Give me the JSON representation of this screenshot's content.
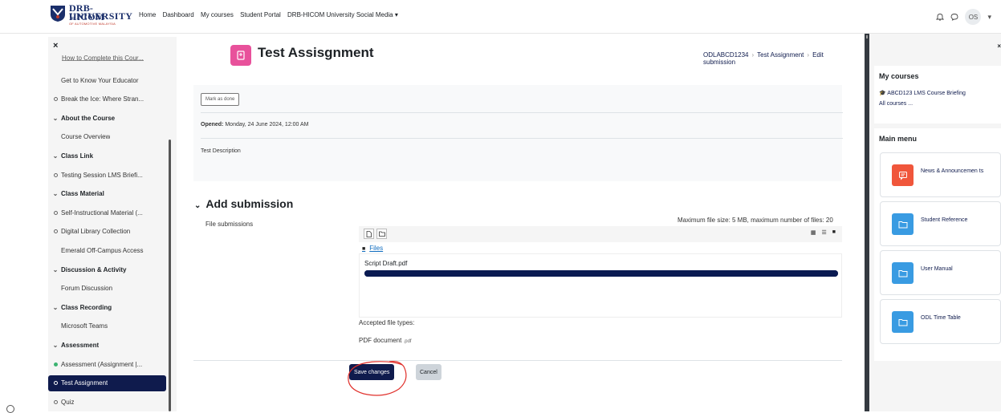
{
  "header": {
    "logo_line1": "DRB-HICOM",
    "logo_line2": "UNIVERSITY",
    "logo_line3": "OF AUTOMOTIVE MALAYSIA",
    "nav": [
      "Home",
      "Dashboard",
      "My courses",
      "Student Portal",
      "DRB-HICOM University Social Media ▾"
    ],
    "avatar_initials": "OS",
    "avatar_caret": "▾"
  },
  "left_drawer": {
    "close": "×",
    "cut_item": "How to Complete this Cour...",
    "items": [
      {
        "label": "Get to Know Your Educator",
        "icon": "none",
        "type": "link"
      },
      {
        "label": "Break the Ice: Where Stran...",
        "icon": "ring",
        "type": "link"
      },
      {
        "label": "About the Course",
        "icon": "chevron",
        "type": "section"
      },
      {
        "label": "Course Overview",
        "icon": "none",
        "type": "link"
      },
      {
        "label": "Class Link",
        "icon": "chevron",
        "type": "section"
      },
      {
        "label": "Testing Session LMS Briefi...",
        "icon": "ring",
        "type": "link"
      },
      {
        "label": "Class Material",
        "icon": "chevron",
        "type": "section"
      },
      {
        "label": "Self-Instructional Material (...",
        "icon": "ring",
        "type": "link"
      },
      {
        "label": "Digital Library Collection",
        "icon": "ring",
        "type": "link"
      },
      {
        "label": "Emerald Off-Campus Access",
        "icon": "none",
        "type": "link"
      },
      {
        "label": "Discussion & Activity",
        "icon": "chevron",
        "type": "section"
      },
      {
        "label": "Forum Discussion",
        "icon": "none",
        "type": "link"
      },
      {
        "label": "Class Recording",
        "icon": "chevron",
        "type": "section"
      },
      {
        "label": "Microsoft Teams",
        "icon": "none",
        "type": "link"
      },
      {
        "label": "Assessment",
        "icon": "chevron",
        "type": "section"
      },
      {
        "label": "Assessment (Assignment |...",
        "icon": "dot-green",
        "type": "link"
      },
      {
        "label": "Test Assignment",
        "icon": "ring",
        "type": "active"
      },
      {
        "label": "Quiz",
        "icon": "ring",
        "type": "link"
      }
    ]
  },
  "main": {
    "title": "Test Assisgnment",
    "title_icon": "assignment-icon",
    "breadcrumb": [
      "ODLABCD1234",
      "Test Assignment",
      "Edit submission"
    ],
    "mark_done": "Mark as done",
    "opened_label": "Opened:",
    "opened_value": "Monday, 24 June 2024, 12:00 AM",
    "description": "Test Description",
    "add_submission": "Add submission",
    "file_submissions_label": "File submissions",
    "max_info": "Maximum file size: 5 MB, maximum number of files: 20",
    "files_link": "Files",
    "file_name": "Script Draft.pdf",
    "upload_progress": 1.0,
    "accepted_label": "Accepted file types:",
    "pdf_label": "PDF document",
    "pdf_ext": ".pdf",
    "save_label": "Save changes",
    "cancel_label": "Cancel"
  },
  "right_drawer": {
    "close": "×",
    "my_courses_title": "My courses",
    "course_link": "ABCD123 LMS Course Briefing",
    "all_courses": "All courses ...",
    "main_menu_title": "Main menu",
    "cards": [
      {
        "label": "News & Announcemen ts",
        "color": "#f0563b",
        "icon": "announcement-icon"
      },
      {
        "label": "Student Reference",
        "color": "#399be2",
        "icon": "folder-icon"
      },
      {
        "label": "User Manual",
        "color": "#399be2",
        "icon": "folder-icon"
      },
      {
        "label": "ODL Time Table",
        "color": "#399be2",
        "icon": "folder-icon"
      }
    ]
  },
  "colors": {
    "brand": "#0f1b4d",
    "accent_pink": "#e8519b",
    "annotation_red": "#e0302b"
  }
}
